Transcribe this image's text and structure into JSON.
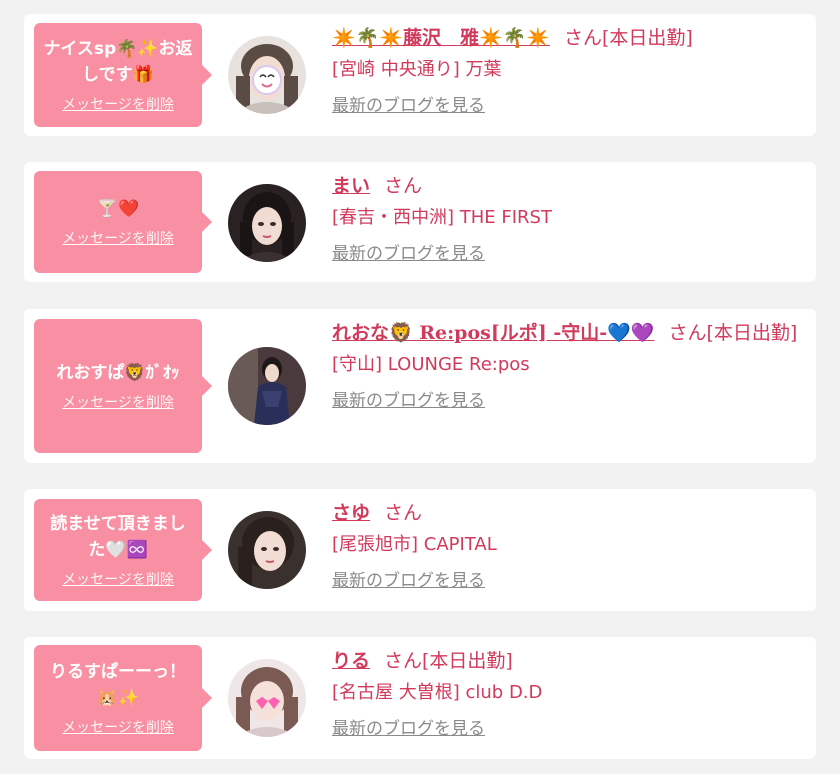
{
  "colors": {
    "accent": "#d23a5c",
    "bubble": "#f98fa2",
    "card": "#ffffff",
    "background": "#f2f2f2",
    "link_gray": "#8a8a8a"
  },
  "labels": {
    "delete": "メッセージを削除",
    "blog": "最新のブログを見る",
    "san": "さん"
  },
  "items": [
    {
      "message": "ナイスsp🌴✨お返しです🎁",
      "name": "✴️🌴✴️藤沢　雅✴️🌴✴️",
      "honorific": "さん[本日出勤]",
      "shop": "[宮崎 中央通り] 万葉",
      "avatar_icon": "avatar-photo"
    },
    {
      "message": "🍸❤️",
      "name": "まい",
      "honorific": "さん",
      "shop": "[春吉・西中洲] THE FIRST",
      "avatar_icon": "avatar-photo"
    },
    {
      "message": "れおすぱ🦁ｶﾞｵｯ",
      "name": "れおな🦁 Re:pos[ルポ] -守山-💙💜",
      "honorific": "さん[本日出勤]",
      "shop": "[守山] LOUNGE Re:pos",
      "avatar_icon": "avatar-photo"
    },
    {
      "message": "読ませて頂きました🤍♾️",
      "name": "さゆ",
      "honorific": "さん",
      "shop": "[尾張旭市] CAPITAL",
      "avatar_icon": "avatar-photo"
    },
    {
      "message": "りるすぱーーっ！🐹✨",
      "name": "りる",
      "honorific": "さん[本日出勤]",
      "shop": "[名古屋 大曽根] club D.D",
      "avatar_icon": "avatar-photo"
    }
  ]
}
